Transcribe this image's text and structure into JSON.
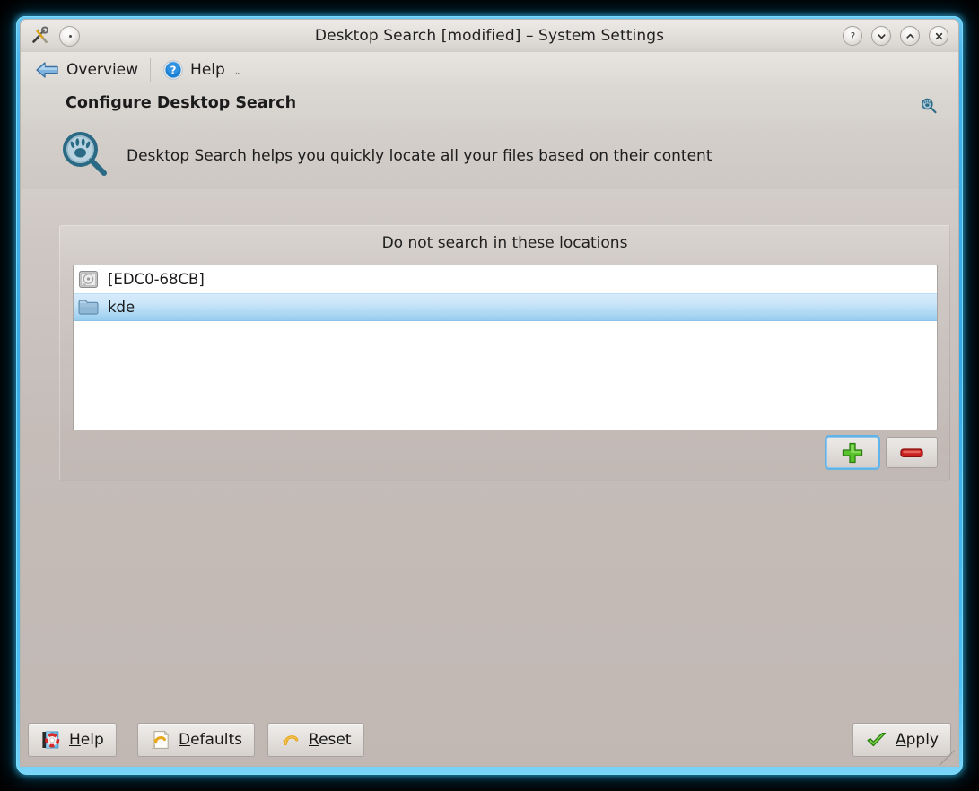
{
  "window": {
    "title": "Desktop Search [modified] – System Settings",
    "left_icons": [
      {
        "name": "tools-icon",
        "label": "tools"
      },
      {
        "name": "menu-button-icon",
        "label": "window-menu"
      }
    ],
    "buttons": [
      {
        "name": "help-window-button",
        "glyph": "?",
        "label": "Help"
      },
      {
        "name": "minimize-window-button",
        "glyph": "⌄",
        "label": "Minimize"
      },
      {
        "name": "maximize-window-button",
        "glyph": "⌃",
        "label": "Maximize"
      },
      {
        "name": "close-window-button",
        "glyph": "✕",
        "label": "Close"
      }
    ],
    "frame_color": "#46b4ec"
  },
  "toolbar": {
    "overview_label": "Overview",
    "help_label": "Help",
    "help_has_dropdown": true
  },
  "page": {
    "title": "Configure Desktop Search",
    "search_icon": "desktop-search-icon",
    "banner_text": "Desktop Search helps you quickly locate all your files based on their content"
  },
  "group": {
    "title": "Do not search in these locations",
    "items": [
      {
        "label": "[EDC0-68CB]",
        "icon": "hard-drive-icon",
        "selected": false
      },
      {
        "label": "kde",
        "icon": "folder-icon",
        "selected": true
      }
    ],
    "add_button": {
      "label": "Add",
      "icon": "plus-icon",
      "focused": true
    },
    "remove_button": {
      "label": "Remove",
      "icon": "minus-icon",
      "focused": false
    }
  },
  "footer": {
    "help": {
      "accel": "H",
      "rest": "elp",
      "icon": "help-book-icon"
    },
    "defaults": {
      "accel": "D",
      "rest": "efaults",
      "icon": "defaults-undo-icon"
    },
    "reset": {
      "accel": "R",
      "rest": "eset",
      "icon": "reset-undo-icon"
    },
    "apply": {
      "accel": "A",
      "rest": "pply",
      "icon": "checkmark-icon"
    }
  },
  "colors": {
    "selection": "#a9d6f2",
    "window_bg": "#c5bcb8",
    "frame": "#46b4ec"
  }
}
